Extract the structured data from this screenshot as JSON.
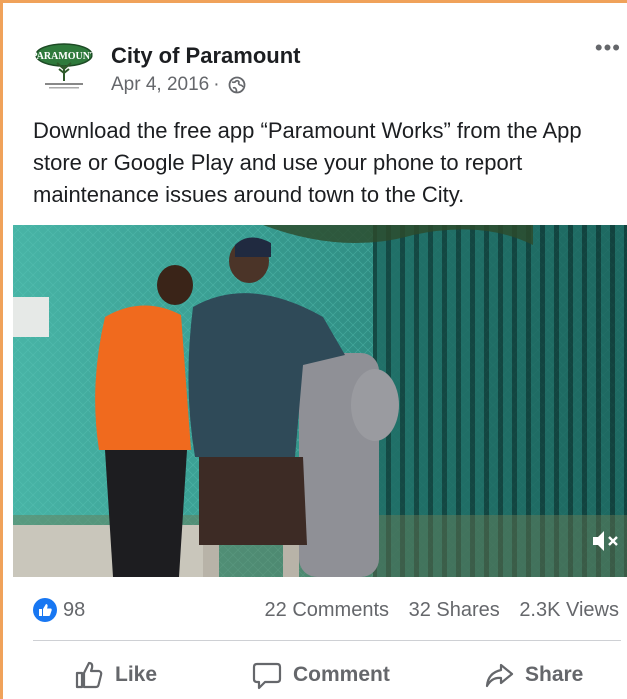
{
  "post": {
    "page_name": "City of Paramount",
    "date": "Apr 4, 2016",
    "separator": "·",
    "privacy_icon": "globe-icon",
    "more_label": "•••",
    "text": "Download the free app “Paramount Works” from the App store or Google Play and use your phone to report maintenance issues around town to the City.",
    "logo_text": "PARAMOUNT"
  },
  "video": {
    "mute_icon": "speaker-muted-icon"
  },
  "stats": {
    "reaction_icon": "thumbs-up-icon",
    "likes": "98",
    "comments": "22 Comments",
    "shares": "32 Shares",
    "views": "2.3K Views"
  },
  "actions": {
    "like": "Like",
    "comment": "Comment",
    "share": "Share"
  },
  "colors": {
    "frame_border": "#f0a25a",
    "accent": "#1877f2",
    "secondary_text": "#65676b"
  }
}
